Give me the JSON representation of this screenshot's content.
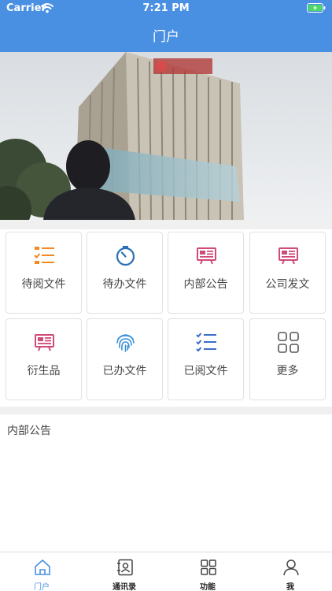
{
  "status_bar": {
    "carrier": "Carrier",
    "time": "7:21 PM"
  },
  "nav": {
    "title": "门户"
  },
  "grid": {
    "items": [
      {
        "label": "待阅文件",
        "icon": "todo-list-icon",
        "color": "#f08a24"
      },
      {
        "label": "待办文件",
        "icon": "timer-icon",
        "color": "#2a6fb5"
      },
      {
        "label": "内部公告",
        "icon": "billboard-icon",
        "color": "#d04a7a"
      },
      {
        "label": "公司发文",
        "icon": "billboard-icon",
        "color": "#d04a7a"
      },
      {
        "label": "衍生品",
        "icon": "billboard-icon",
        "color": "#d04a7a"
      },
      {
        "label": "已办文件",
        "icon": "fingerprint-icon",
        "color": "#3a8fd8"
      },
      {
        "label": "已阅文件",
        "icon": "checklist-icon",
        "color": "#3a6fc8"
      },
      {
        "label": "更多",
        "icon": "grid-icon",
        "color": "#555555"
      }
    ]
  },
  "notices": {
    "title": "内部公告"
  },
  "tabbar": {
    "items": [
      {
        "label": "门户",
        "icon": "home-icon",
        "active": true
      },
      {
        "label": "通讯录",
        "icon": "contacts-icon",
        "active": false
      },
      {
        "label": "功能",
        "icon": "apps-icon",
        "active": false
      },
      {
        "label": "我",
        "icon": "person-icon",
        "active": false
      }
    ]
  },
  "colors": {
    "accent": "#4a90e2",
    "divider": "#f0f0f0"
  }
}
